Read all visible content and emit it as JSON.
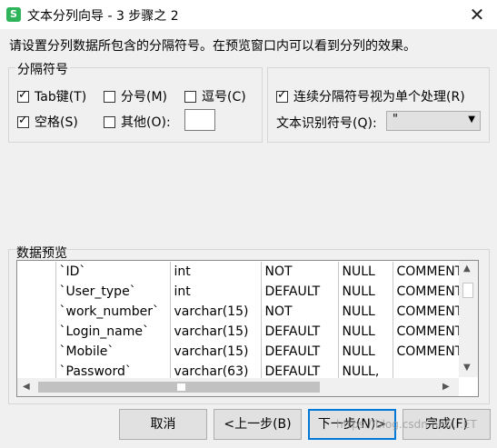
{
  "window": {
    "title": "文本分列向导 - 3 步骤之 2",
    "icon_letter": "S",
    "close_glyph": "✕"
  },
  "instruction": "请设置分列数据所包含的分隔符号。在预览窗口内可以看到分列的效果。",
  "separators": {
    "legend": "分隔符号",
    "options": [
      {
        "label": "Tab键(T)",
        "checked": true
      },
      {
        "label": "分号(M)",
        "checked": false
      },
      {
        "label": "逗号(C)",
        "checked": false
      },
      {
        "label": "空格(S)",
        "checked": true
      },
      {
        "label": "其他(O):",
        "checked": false
      }
    ],
    "other_value": ""
  },
  "options_group": {
    "consecutive_label": "连续分隔符号视为单个处理(R)",
    "consecutive_checked": true,
    "text_qualifier_label": "文本识别符号(Q):",
    "text_qualifier_value": "\""
  },
  "preview": {
    "label": "数据预览",
    "rows": [
      [
        "",
        "`ID`",
        "int",
        "NOT",
        "NULL",
        "COMMENT"
      ],
      [
        "",
        "`User_type`",
        "int",
        "DEFAULT",
        "NULL",
        "COMMENT"
      ],
      [
        "",
        "`work_number`",
        "varchar(15)",
        "NOT",
        "NULL",
        "COMMENT"
      ],
      [
        "",
        "`Login_name`",
        "varchar(15)",
        "DEFAULT",
        "NULL",
        "COMMENT"
      ],
      [
        "",
        "`Mobile`",
        "varchar(15)",
        "DEFAULT",
        "NULL",
        "COMMENT"
      ],
      [
        "",
        "`Password`",
        "varchar(63)",
        "DEFAULT",
        "NULL,",
        ""
      ]
    ]
  },
  "buttons": {
    "cancel": "取消",
    "back": "<上一步(B)",
    "next": "下一步(N)>",
    "finish": "完成(F)"
  },
  "watermark": "https://blog.csdn.net/...ET"
}
